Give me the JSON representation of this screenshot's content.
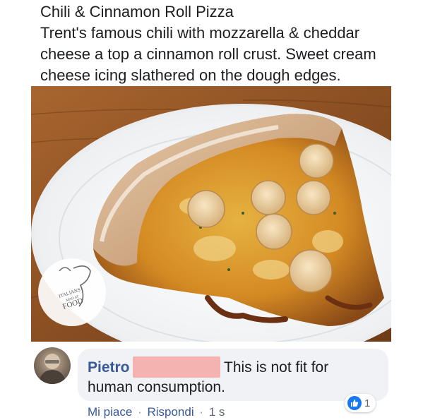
{
  "post": {
    "lines": [
      "Chili & Cinnamon Roll Pizza",
      "Trent's famous chili with mozzarella & cheddar",
      "cheese a top a cinnamon roll crust. Sweet cream",
      "cheese icing slathered on the dough edges."
    ]
  },
  "photo": {
    "watermark_lines": [
      "ITALIANS",
      "MAD AT",
      "FOOD"
    ]
  },
  "comment": {
    "author": "Pietro",
    "text_line1": "This is not fit for",
    "text_line2": "human consumption.",
    "reaction_count": "1",
    "actions": {
      "like": "Mi piace",
      "reply": "Rispondi",
      "time": "1 s",
      "separator": "·"
    }
  },
  "colors": {
    "link": "#385898",
    "bubble": "#f0f2f5",
    "like_blue": "#1877f2",
    "redaction": "#f4b3b1"
  }
}
